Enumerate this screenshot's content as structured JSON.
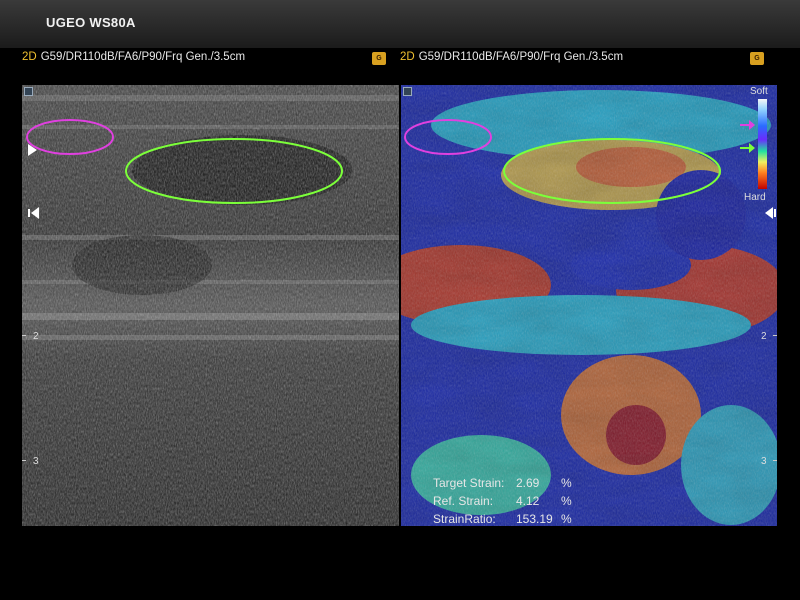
{
  "title": "UGEO WS80A",
  "left_panel": {
    "mode": "2D",
    "params": "G59/DR110dB/FA6/P90/Frq Gen./3.5cm",
    "depth_marks": [
      "2",
      "3"
    ]
  },
  "right_panel": {
    "mode": "2D",
    "params": "G59/DR110dB/FA6/P90/Frq Gen./3.5cm",
    "depth_marks": [
      "2",
      "3"
    ]
  },
  "colorbar": {
    "top_label": "Soft",
    "bottom_label": "Hard"
  },
  "strain": [
    {
      "label": "Target Strain:",
      "value": "2.69",
      "unit": "%"
    },
    {
      "label": "Ref. Strain:",
      "value": "4.12",
      "unit": "%"
    },
    {
      "label": "StrainRatio:",
      "value": "153.19",
      "unit": "%"
    }
  ],
  "colors": {
    "roi_reference": "#e040e0",
    "roi_target": "#7cff3a",
    "mode_tag": "#f0c030"
  }
}
